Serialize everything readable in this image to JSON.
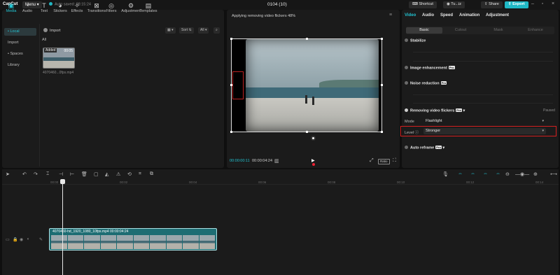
{
  "titlebar": {
    "app_name": "CapCut",
    "menu_label": "Menu",
    "autosave_text": "Auto saved: 08:15:24",
    "project_title": "0104 (10)",
    "shortcut_label": "Shortcut",
    "user_label": "Tu...iz",
    "share_label": "Share",
    "export_label": "Export"
  },
  "toolbar": {
    "tabs": [
      {
        "label": "Media",
        "icon": "media-icon",
        "glyph": "▣"
      },
      {
        "label": "Audio",
        "icon": "audio-icon",
        "glyph": "◔"
      },
      {
        "label": "Text",
        "icon": "text-icon",
        "glyph": "T"
      },
      {
        "label": "Stickers",
        "icon": "stickers-icon",
        "glyph": "◕"
      },
      {
        "label": "Effects",
        "icon": "effects-icon",
        "glyph": "✧"
      },
      {
        "label": "Transitions",
        "icon": "transitions-icon",
        "glyph": "⊠"
      },
      {
        "label": "Filters",
        "icon": "filters-icon",
        "glyph": "◎"
      },
      {
        "label": "Adjustment",
        "icon": "adjustment-icon",
        "glyph": "⚙"
      },
      {
        "label": "Templates",
        "icon": "templates-icon",
        "glyph": "▤"
      }
    ]
  },
  "media": {
    "nav": [
      "• Local",
      "Import",
      "• Spaces",
      "Library"
    ],
    "import_label": "Import",
    "sort_label": "Sort",
    "all_filter_label": "All",
    "all_label": "All",
    "thumb_added": "Added",
    "thumb_duration": "00:05",
    "thumb_name": "4070460...0fps.mp4"
  },
  "player": {
    "status": "Applying removing video flickers 48%",
    "time_current": "00:00:00:11",
    "time_total": "00:00:04:24",
    "ratio_label": "Ratio"
  },
  "inspector": {
    "tabs": [
      "Video",
      "Audio",
      "Speed",
      "Animation",
      "Adjustment"
    ],
    "subtabs": [
      "Basic",
      "Cutout",
      "Mask",
      "Enhance"
    ],
    "stabilize": "Stabilize",
    "image_enhancement": "Image enhancement",
    "noise_reduction": "Noise reduction",
    "removing_flickers": "Removing video flickers",
    "paused_label": "Paused",
    "mode_label": "Mode",
    "mode_value": "Flashlight",
    "level_label": "Level",
    "level_value": "Stronger",
    "auto_reframe": "Auto reframe",
    "pro_badge": "Pro"
  },
  "timeline": {
    "ticks": [
      "00:00",
      "00:02",
      "00:04",
      "00:06",
      "00:08",
      "00:10",
      "00:12",
      "00:14"
    ],
    "clip_label": "4070460-hd_1920_1080_10fps.mp4  00:00:04:24"
  },
  "colors": {
    "accent": "#22c4d2",
    "highlight_border": "#d32020",
    "clip": "#1d6d73"
  }
}
